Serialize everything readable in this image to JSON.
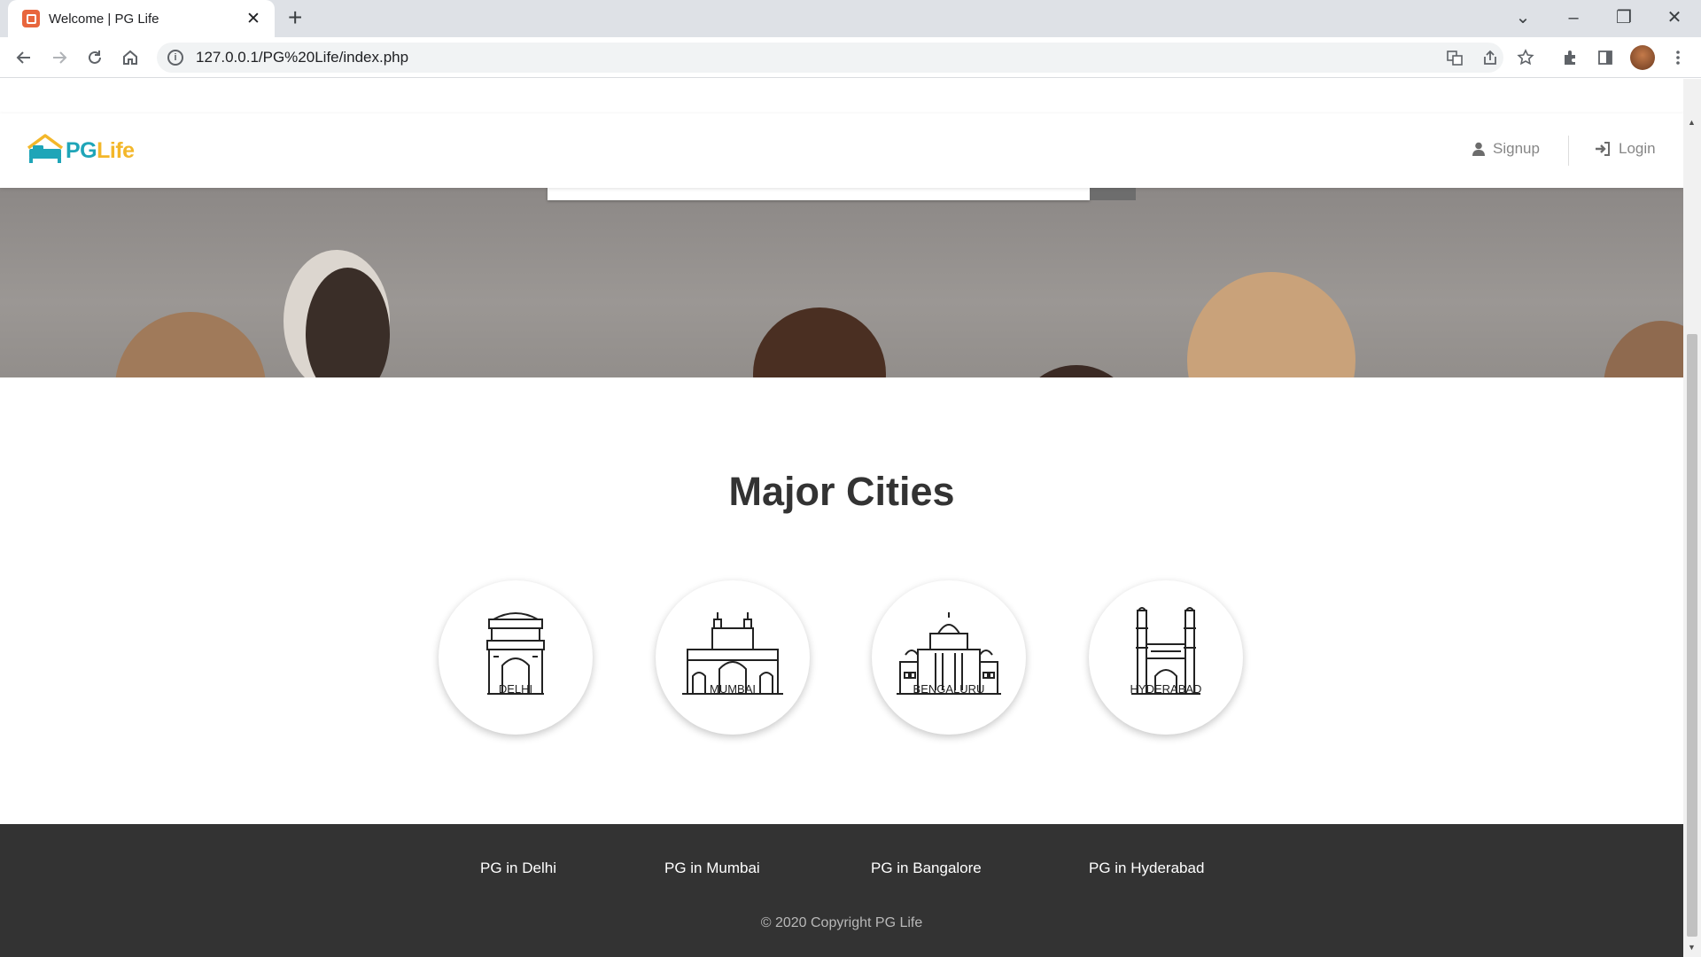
{
  "browser": {
    "tab_title": "Welcome | PG Life",
    "tab_close": "✕",
    "new_tab": "+",
    "url": "127.0.0.1/PG%20Life/index.php",
    "controls": {
      "dropdown": "⌄",
      "minimize": "–",
      "restore": "❐",
      "close": "✕"
    }
  },
  "site": {
    "logo_pg": "PG",
    "logo_life": "Life",
    "nav": {
      "signup": "Signup",
      "login": "Login"
    },
    "section_title": "Major Cities",
    "cities": [
      {
        "label": "DELHI"
      },
      {
        "label": "MUMBAI"
      },
      {
        "label": "BENGALURU"
      },
      {
        "label": "HYDERABAD"
      }
    ],
    "footer": {
      "links": [
        "PG in Delhi",
        "PG in Mumbai",
        "PG in Bangalore",
        "PG in Hyderabad"
      ],
      "copyright": "© 2020 Copyright PG Life"
    }
  },
  "colors": {
    "logo_teal": "#1fa5b8",
    "logo_yellow": "#f3b72a",
    "footer_bg": "#333333"
  }
}
